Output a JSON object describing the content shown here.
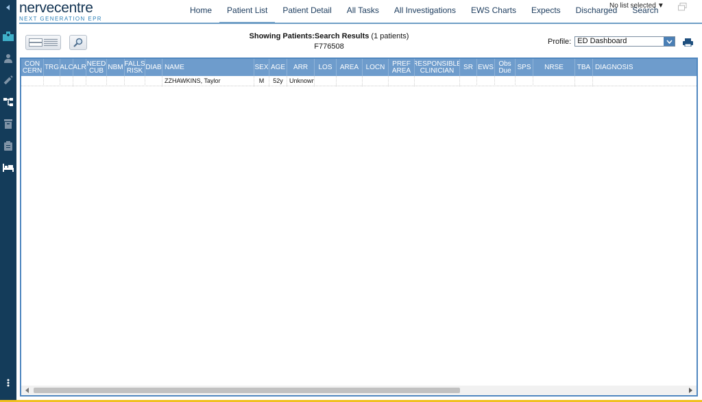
{
  "brand": {
    "name": "nervecentre",
    "tagline": "NEXT GENERATION EPR"
  },
  "nav": [
    {
      "label": "Home"
    },
    {
      "label": "Patient List",
      "active": true
    },
    {
      "label": "Patient Detail"
    },
    {
      "label": "All Tasks"
    },
    {
      "label": "All Investigations"
    },
    {
      "label": "EWS Charts"
    },
    {
      "label": "Expects"
    },
    {
      "label": "Discharged"
    },
    {
      "label": "Search"
    }
  ],
  "list_selector": {
    "label": "No list selected"
  },
  "rail_icons": [
    "collapse-arrow-icon",
    "hospital-icon",
    "patient-icon",
    "syringe-icon",
    "network-icon",
    "archive-icon",
    "clipboard-icon",
    "bed-icon",
    "more-vertical-icon"
  ],
  "header_info": {
    "prefix": "Showing Patients:",
    "title": "Search Results",
    "count": "(1 patients)",
    "query": "F776508"
  },
  "profile": {
    "label": "Profile:",
    "value": "ED Dashboard"
  },
  "columns": [
    "CON CERN",
    "TRG",
    "ALC",
    "ALR",
    "NEED CUB",
    "NBM",
    "FALLS RISK",
    "DIAB",
    "NAME",
    "SEX",
    "AGE",
    "ARR",
    "LOS",
    "AREA",
    "LOCN",
    "PREF AREA",
    "RESPONSIBLE CLINICIAN",
    "SR",
    "EWS",
    "Obs Due",
    "SPS",
    "NRSE",
    "TBA",
    "DIAGNOSIS"
  ],
  "rows": [
    {
      "name": "ZZHAWKINS, Taylor",
      "sex": "M",
      "age": "52y",
      "arr": "Unknown"
    }
  ],
  "colors": {
    "rail": "#143c5a",
    "header_row": "#6e9ccc",
    "accent": "#4f87bf",
    "brand": "#133453"
  }
}
